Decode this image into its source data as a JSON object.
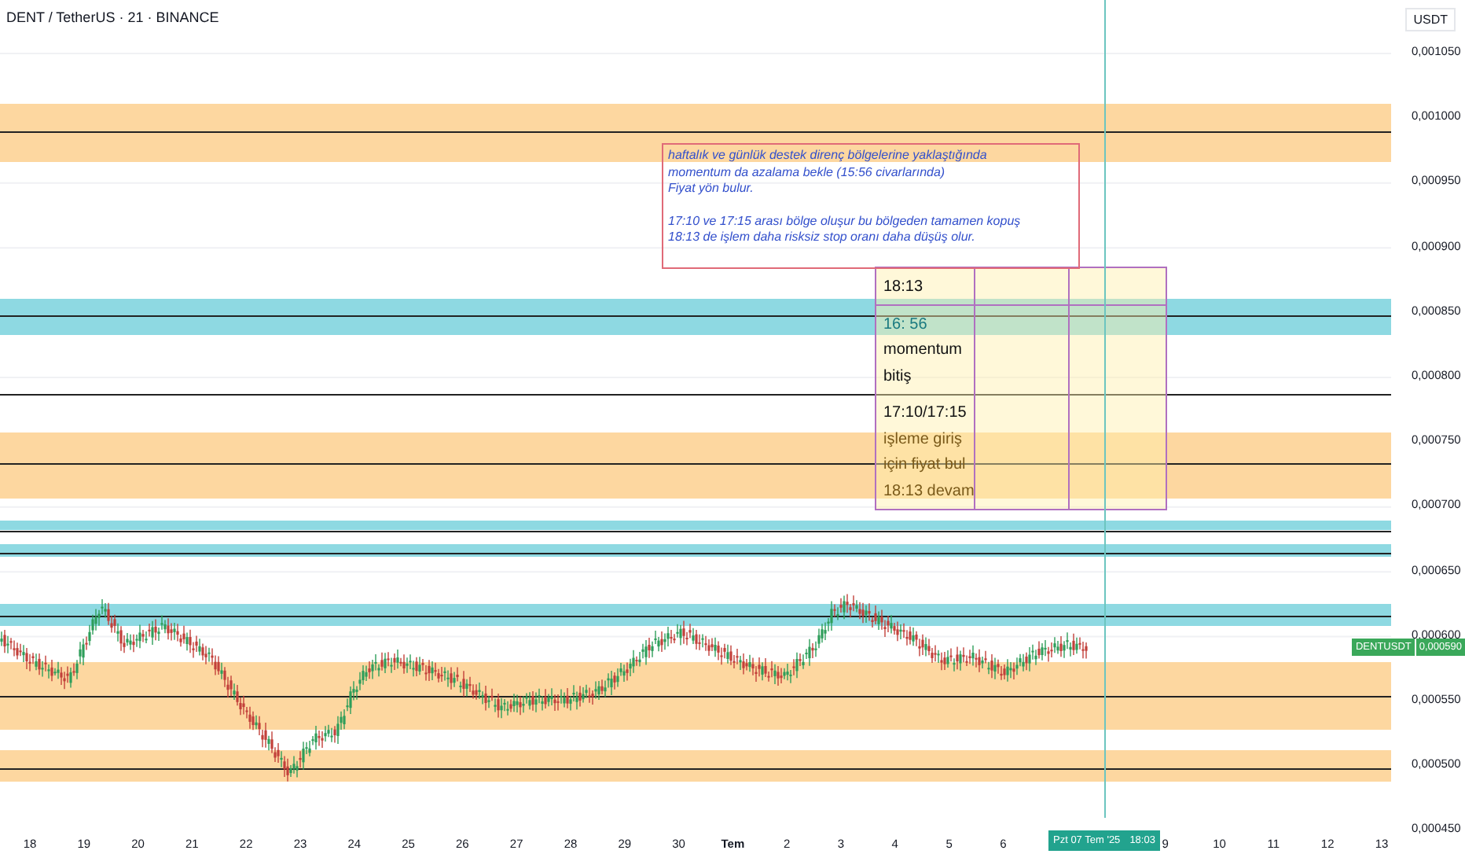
{
  "header": {
    "title": "DENT / TetherUS · 21 · BINANCE",
    "currency": "USDT"
  },
  "price_axis": [
    "0,001050",
    "0,001000",
    "0,000950",
    "0,000900",
    "0,000850",
    "0,000800",
    "0,000750",
    "0,000700",
    "0,000650",
    "0,000600",
    "0,000550",
    "0,000500",
    "0,000450"
  ],
  "time_axis": [
    {
      "label": "18",
      "kind": "day"
    },
    {
      "label": "19",
      "kind": "day"
    },
    {
      "label": "20",
      "kind": "day"
    },
    {
      "label": "21",
      "kind": "day"
    },
    {
      "label": "22",
      "kind": "day"
    },
    {
      "label": "23",
      "kind": "day"
    },
    {
      "label": "24",
      "kind": "day"
    },
    {
      "label": "25",
      "kind": "day"
    },
    {
      "label": "26",
      "kind": "day"
    },
    {
      "label": "27",
      "kind": "day"
    },
    {
      "label": "28",
      "kind": "day"
    },
    {
      "label": "29",
      "kind": "day"
    },
    {
      "label": "30",
      "kind": "day"
    },
    {
      "label": "Tem",
      "kind": "month"
    },
    {
      "label": "2",
      "kind": "day"
    },
    {
      "label": "3",
      "kind": "day"
    },
    {
      "label": "4",
      "kind": "day"
    },
    {
      "label": "5",
      "kind": "day"
    },
    {
      "label": "6",
      "kind": "day"
    },
    {
      "label": "9",
      "kind": "day"
    },
    {
      "label": "10",
      "kind": "day"
    },
    {
      "label": "11",
      "kind": "day"
    },
    {
      "label": "12",
      "kind": "day"
    },
    {
      "label": "13",
      "kind": "day"
    }
  ],
  "crosshair": {
    "date": "Pzt 07 Tem '25",
    "time": "18:03"
  },
  "last_price": {
    "symbol": "DENTUSDT",
    "price": "0,000590"
  },
  "note": {
    "paragraphs": [
      "haftalık ve günlük destek direnç bölgelerine yaklaştığında\nmomentum da azalama bekle (15:56 civarlarında)\nFiyat yön bulur.",
      "17:10 ve 17:15 arası bölge oluşur bu bölgeden tamamen kopuş\n18:13 de işlem daha risksiz stop oranı daha düşüş olur."
    ]
  },
  "timeline_box": {
    "lines": [
      {
        "text": "18:13",
        "color": "#111111"
      },
      {
        "text": "16: 56",
        "color": "#1a7a80"
      },
      {
        "text": "momentum",
        "color": "#111111"
      },
      {
        "text": "bitiş",
        "color": "#111111"
      },
      {
        "text": "17:10/17:15",
        "color": "#111111"
      },
      {
        "text": "işleme giriş",
        "color": "#7a5a1a"
      },
      {
        "text": "için fiyat bul",
        "color": "#7a5a1a"
      },
      {
        "text": "18:13 devam",
        "color": "#7a5a1a"
      }
    ]
  }
}
